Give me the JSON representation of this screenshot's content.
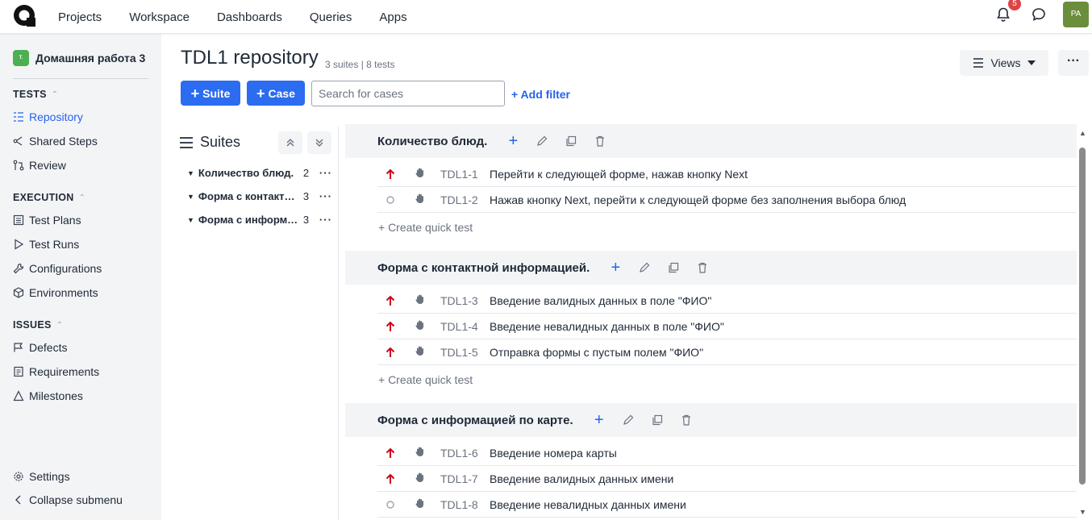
{
  "topnav": {
    "items": [
      "Projects",
      "Workspace",
      "Dashboards",
      "Queries",
      "Apps"
    ],
    "notifications_count": "5",
    "avatar_initials": "PA"
  },
  "sidebar": {
    "project_icon_text": "T.",
    "project_name": "Домашняя работа 3",
    "tests_header": "TESTS",
    "tests_items": [
      {
        "label": "Repository",
        "icon": "repository-icon"
      },
      {
        "label": "Shared Steps",
        "icon": "shared-steps-icon"
      },
      {
        "label": "Review",
        "icon": "review-icon"
      }
    ],
    "execution_header": "EXECUTION",
    "execution_items": [
      {
        "label": "Test Plans",
        "icon": "test-plans-icon"
      },
      {
        "label": "Test Runs",
        "icon": "play-icon"
      },
      {
        "label": "Configurations",
        "icon": "wrench-icon"
      },
      {
        "label": "Environments",
        "icon": "cube-icon"
      }
    ],
    "issues_header": "ISSUES",
    "issues_items": [
      {
        "label": "Defects",
        "icon": "defects-icon"
      },
      {
        "label": "Requirements",
        "icon": "requirements-icon"
      },
      {
        "label": "Milestones",
        "icon": "milestones-icon"
      }
    ],
    "settings_label": "Settings",
    "collapse_label": "Collapse submenu"
  },
  "header": {
    "title": "TDL1 repository",
    "subtitle": "3 suites | 8 tests",
    "views_label": "Views",
    "more_label": "···"
  },
  "toolbar": {
    "suite_label": "Suite",
    "case_label": "Case",
    "search_placeholder": "Search for cases",
    "filter_label": "+ Add filter"
  },
  "suites_panel": {
    "title": "Suites",
    "items": [
      {
        "name": "Количество блюд.",
        "count": "2"
      },
      {
        "name": "Форма с контактной информацией.",
        "count": "3"
      },
      {
        "name": "Форма с информацией по карте.",
        "count": "3"
      }
    ]
  },
  "suites": [
    {
      "name": "Количество блюд.",
      "cases": [
        {
          "priority": "high",
          "id": "TDL1-1",
          "title": "Перейти к следующей форме, нажав кнопку Next"
        },
        {
          "priority": "normal",
          "id": "TDL1-2",
          "title": "Нажав кнопку Next, перейти к следующей форме без заполнения выбора блюд"
        }
      ]
    },
    {
      "name": "Форма с контактной информацией.",
      "cases": [
        {
          "priority": "high",
          "id": "TDL1-3",
          "title": "Введение валидных данных в поле \"ФИО\""
        },
        {
          "priority": "high",
          "id": "TDL1-4",
          "title": "Введение невалидных данных в поле \"ФИО\""
        },
        {
          "priority": "high",
          "id": "TDL1-5",
          "title": "Отправка формы с пустым полем \"ФИО\""
        }
      ]
    },
    {
      "name": "Форма с информацией по карте.",
      "cases": [
        {
          "priority": "high",
          "id": "TDL1-6",
          "title": "Введение номера карты"
        },
        {
          "priority": "high",
          "id": "TDL1-7",
          "title": "Введение валидных данных имени"
        },
        {
          "priority": "normal",
          "id": "TDL1-8",
          "title": "Введение невалидных данных имени"
        }
      ]
    }
  ],
  "quick_test_label": "+ Create quick test",
  "colors": {
    "accent": "#2b6cf0",
    "priority_high": "#d0021b",
    "sidebar_bg": "#f3f4f6"
  }
}
